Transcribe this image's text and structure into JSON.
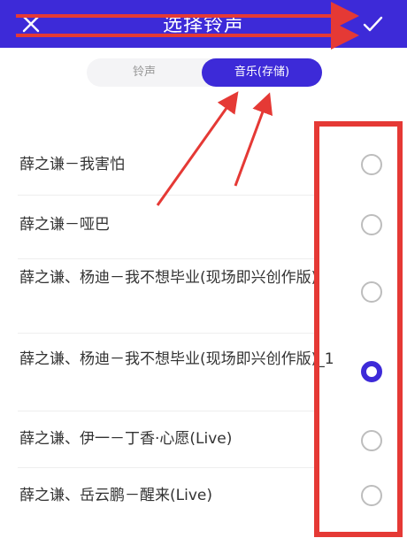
{
  "header": {
    "title": "选择铃声",
    "close_icon": "close-icon",
    "confirm_icon": "check-icon"
  },
  "tabs": [
    {
      "label": "铃声",
      "selected": false
    },
    {
      "label": "音乐(存储)",
      "selected": true
    }
  ],
  "songs": [
    {
      "title": "薛之谦－我害怕",
      "selected": false
    },
    {
      "title": "薛之谦－哑巴",
      "selected": false
    },
    {
      "title": "薛之谦、杨迪－我不想毕业(现场即兴创作版)",
      "selected": false
    },
    {
      "title": "薛之谦、杨迪－我不想毕业(现场即兴创作版)_1",
      "selected": true
    },
    {
      "title": "薛之谦、伊一－丁香·心愿(Live)",
      "selected": false
    },
    {
      "title": "薛之谦、岳云鹏－醒来(Live)",
      "selected": false
    }
  ],
  "colors": {
    "accent": "#3d2ad8",
    "annotation": "#e53935"
  }
}
